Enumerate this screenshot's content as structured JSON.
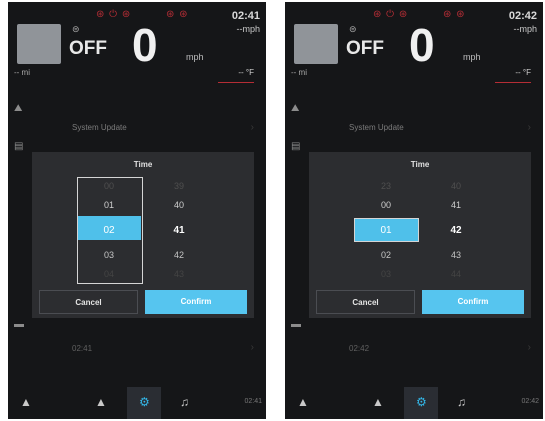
{
  "screens": [
    {
      "header": {
        "warning_icons_left": "⊛ ⏻ ⊛",
        "warning_icons_right": "⊛ ⊛",
        "clock": "02:41",
        "speed_unit_readout": "--mph",
        "gear_text": "⊜",
        "status": "OFF",
        "speed": "0",
        "speed_unit": "mph",
        "odometer": "-- mi",
        "temperature": "-- °F"
      },
      "menu": {
        "system_update": "System Update"
      },
      "dialog": {
        "title": "Time",
        "hours": [
          "00",
          "01",
          "02",
          "03",
          "04"
        ],
        "minutes": [
          "39",
          "40",
          "41",
          "42",
          "43"
        ],
        "cancel": "Cancel",
        "confirm": "Confirm"
      },
      "bottom_time": "02:41",
      "nav_time": "02:41",
      "accent": "#4fc0ea"
    },
    {
      "header": {
        "warning_icons_left": "⊛ ⏻ ⊛",
        "warning_icons_right": "⊛ ⊛",
        "clock": "02:42",
        "speed_unit_readout": "--mph",
        "gear_text": "⊜",
        "status": "OFF",
        "speed": "0",
        "speed_unit": "mph",
        "odometer": "-- mi",
        "temperature": "-- °F"
      },
      "menu": {
        "system_update": "System Update"
      },
      "dialog": {
        "title": "Time",
        "hours": [
          "23",
          "00",
          "01",
          "02",
          "03"
        ],
        "minutes": [
          "40",
          "41",
          "42",
          "43",
          "44"
        ],
        "cancel": "Cancel",
        "confirm": "Confirm"
      },
      "bottom_time": "02:42",
      "nav_time": "02:42",
      "accent": "#4fc0ea"
    }
  ]
}
